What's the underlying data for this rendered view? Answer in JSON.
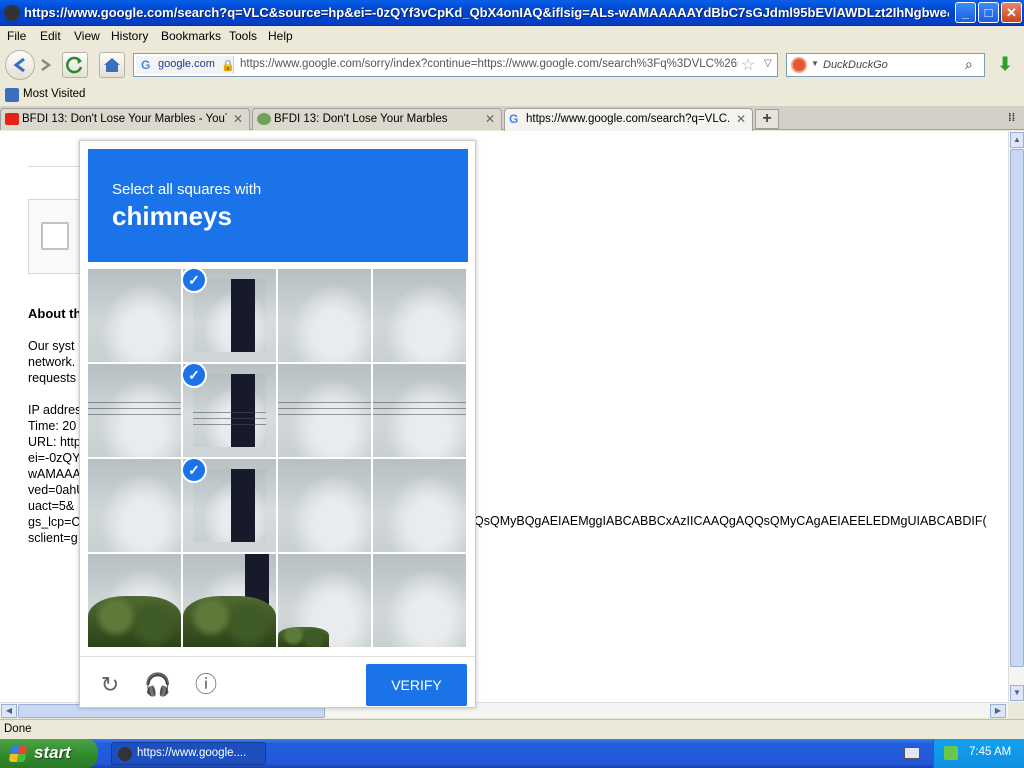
{
  "window": {
    "title": "https://www.google.com/search?q=VLC&source=hp&ei=-0zQYf3vCpKd_QbX4onIAQ&iflsig=ALs-wAMAAAAAYdBbC7sGJdml95bEVlAWDLzt2IhNgbwe&v...",
    "minimize": "_",
    "maximize": "□",
    "close": "✕"
  },
  "menu": [
    "File",
    "Edit",
    "View",
    "History",
    "Bookmarks",
    "Tools",
    "Help"
  ],
  "nav": {
    "identity_host": "google.com",
    "url": "https://www.google.com/sorry/index?continue=https://www.google.com/search%3Fq%3DVLC%26sc",
    "search_placeholder": "DuckDuckGo"
  },
  "bookmarks": {
    "most_visited": "Most Visited"
  },
  "tabs": [
    {
      "label": "BFDI 13: Don't Lose Your Marbles - YouT...",
      "icon": "youtube-icon"
    },
    {
      "label": "BFDI 13: Don't Lose Your Marbles",
      "icon": "leaf-icon"
    },
    {
      "label": "https://www.google.com/search?q=VLC...",
      "icon": "google-icon"
    }
  ],
  "page": {
    "about": "About th",
    "para_lines": [
      "Our syst",
      "network.",
      "requests"
    ],
    "meta_lines": [
      "IP addres",
      "Time: 20",
      "URL: http",
      "ei=-0zQY",
      "wAMAAA",
      "ved=0ahU",
      "uact=5&",
      "gs_lcp=C",
      "sclient=g"
    ],
    "gslcp_tail": "QsQMyBQgAEIAEMggIABCABBCxAzIICAAQgAQQsQMyCAgAEIAEELEDMgUIABCABDIF("
  },
  "captcha": {
    "prompt": "Select all squares with",
    "target": "chimneys",
    "verify_label": "VERIFY",
    "selected_tiles": [
      1,
      5,
      9
    ]
  },
  "status": {
    "text": "Done"
  },
  "taskbar": {
    "start_label": "start",
    "task_label": "https://www.google....",
    "clock": "7:45 AM"
  }
}
